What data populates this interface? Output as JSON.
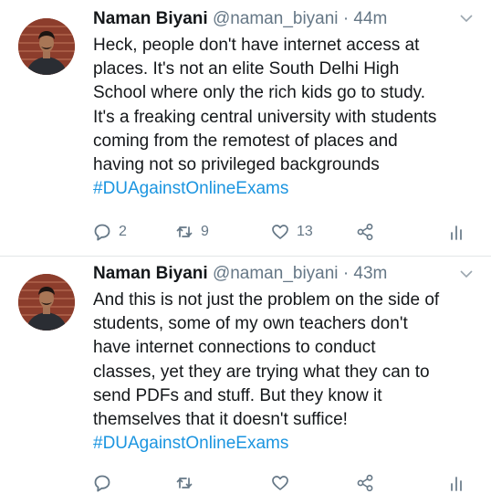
{
  "tweets": [
    {
      "name": "Naman Biyani",
      "handle": "@naman_biyani",
      "separator": "·",
      "time": "44m",
      "lines": [
        "Heck, people don't have internet access at",
        "places. It's not an elite South Delhi High",
        "School where only the rich kids go to study.",
        "It's a freaking central university with students",
        "coming from the remotest of places and",
        "having not so privileged backgrounds"
      ],
      "hashtag": "#DUAgainstOnlineExams",
      "replies": "2",
      "retweets": "9",
      "likes": "13"
    },
    {
      "name": "Naman Biyani",
      "handle": "@naman_biyani",
      "separator": "·",
      "time": "43m",
      "lines": [
        "And this is not just the problem on the side of",
        "students, some of my own teachers don't",
        "have internet connections to conduct",
        "classes, yet they are trying what they can to",
        "send PDFs and stuff. But they know it",
        "themselves that it doesn't suffice!"
      ],
      "hashtag": "#DUAgainstOnlineExams"
    }
  ],
  "icons": {
    "reply": "reply-icon",
    "retweet": "retweet-icon",
    "like": "heart-icon",
    "share": "share-icon",
    "analytics": "analytics-icon",
    "caret": "chevron-down-icon"
  },
  "colors": {
    "text": "#14171a",
    "secondary": "#657786",
    "hashtag": "#1b95e0",
    "avatar_bg": "#8c3d2c"
  }
}
